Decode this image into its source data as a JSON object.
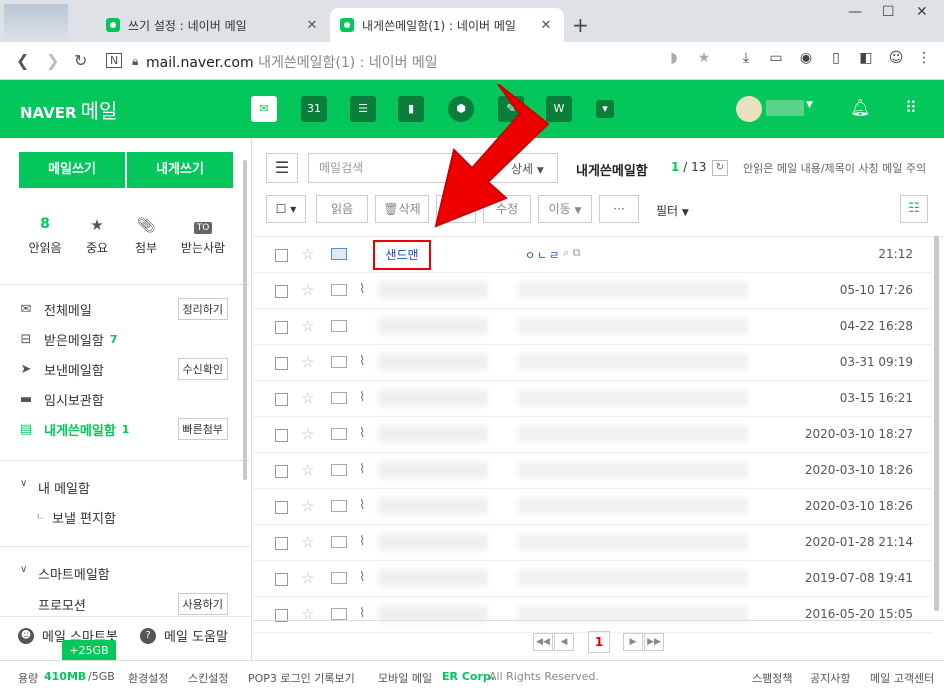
{
  "browser": {
    "tabs": [
      {
        "title": "쓰기 설정 : 네이버 메일",
        "close": "✕"
      },
      {
        "title": "내게쓴메일함(1) : 네이버 메일",
        "close": "✕"
      }
    ],
    "new_tab": "+",
    "url_host": "mail.naver.com",
    "url_title": "내게쓴메일함(1) : 네이버 메일"
  },
  "header": {
    "brand": "NAVER",
    "brand_mail": "메일",
    "icons": [
      "mail-icon",
      "calendar-icon",
      "list-icon",
      "contacts-icon",
      "cube-icon",
      "memo-icon",
      "works-icon",
      "more-icon"
    ],
    "calendar_label": "31"
  },
  "sidebar": {
    "write_mail": "메일쓰기",
    "write_self": "내게쓰기",
    "shortcuts": [
      {
        "label": "안읽음",
        "value": "8"
      },
      {
        "label": "중요"
      },
      {
        "label": "첨부"
      },
      {
        "label": "받는사람",
        "badge": "TO"
      }
    ],
    "folders": [
      {
        "label": "전체메일",
        "button": "정리하기"
      },
      {
        "label": "받은메일함",
        "count": "7"
      },
      {
        "label": "보낸메일함",
        "button": "수신확인"
      },
      {
        "label": "임시보관함"
      },
      {
        "label": "내게쓴메일함",
        "count": "1",
        "button": "빠른첨부"
      }
    ],
    "my_folders_title": "내 메일함",
    "my_folders": [
      {
        "label": "보낼 편지함",
        "prefix": "ㄴ"
      }
    ],
    "smart_title": "스마트메일함",
    "smart_items": [
      {
        "label": "프로모션",
        "button": "사용하기"
      }
    ],
    "bottom_links": [
      {
        "label": "메일 스마트봇"
      },
      {
        "label": "메일 도움말",
        "icon_text": "?"
      }
    ]
  },
  "toolbar": {
    "search_placeholder": "메일검색",
    "detail": "상세",
    "folder_name": "내게쓴메일함",
    "page_current": "1",
    "page_sep": "/",
    "page_total": "13",
    "notice": "안읽은 메일 내용/제목이 사칭 메일 주의",
    "read": "읽음",
    "delete": "삭제",
    "edit": "수정",
    "move": "이동",
    "more": "···",
    "filter": "필터"
  },
  "mails": [
    {
      "sender": "샌드맨",
      "subject": "ㅇㄴㄹ",
      "date": "21:12",
      "attach": false,
      "unread": true
    },
    {
      "date": "05-10 17:26",
      "attach": true
    },
    {
      "date": "04-22 16:28",
      "attach": false
    },
    {
      "date": "03-31 09:19",
      "attach": true
    },
    {
      "date": "03-15 16:21",
      "attach": true
    },
    {
      "date": "2020-03-10 18:27",
      "attach": true
    },
    {
      "date": "2020-03-10 18:26",
      "attach": true
    },
    {
      "date": "2020-03-10 18:26",
      "attach": true
    },
    {
      "date": "2020-01-28 21:14",
      "attach": true
    },
    {
      "date": "2019-07-08 19:41",
      "attach": true
    },
    {
      "date": "2016-05-20 15:05",
      "attach": true
    }
  ],
  "pager": {
    "current": "1"
  },
  "status": {
    "usage_label": "용량",
    "usage": "410MB",
    "total": "/5GB",
    "plus": "+25GB",
    "settings": "환경설정",
    "skin": "스킨설정",
    "pop3": "POP3 로그인 기록보기",
    "mobile": "모바일 메일",
    "corp": "ER Corp.",
    "rights": "All Rights Reserved.",
    "spam": "스팸정책",
    "notice": "공지사항",
    "support": "메일 고객센터"
  },
  "colors": {
    "naver_green": "#03c75a",
    "annotation_red": "#ee0000"
  }
}
